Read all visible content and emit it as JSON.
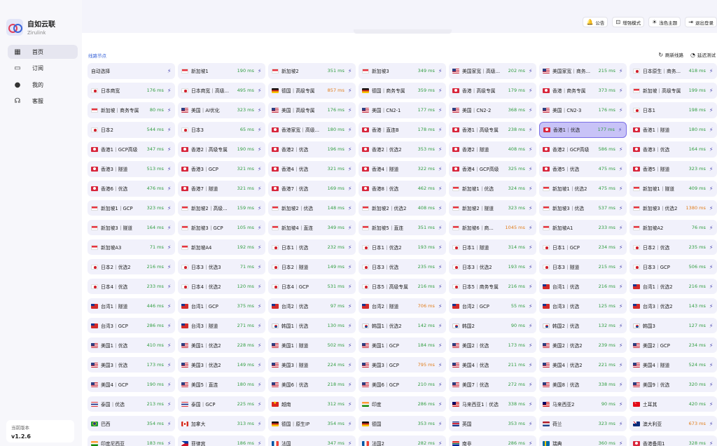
{
  "brand": {
    "name": "自如云联",
    "sub": "Zirulink"
  },
  "nav": [
    {
      "label": "首页",
      "icon": "dashboard-icon",
      "glyph": "▦",
      "active": true
    },
    {
      "label": "订阅",
      "icon": "monitor-icon",
      "glyph": "▭",
      "active": false
    },
    {
      "label": "我的",
      "icon": "user-icon",
      "glyph": "●",
      "active": false
    },
    {
      "label": "客服",
      "icon": "headset-icon",
      "glyph": "☊",
      "active": false
    }
  ],
  "version": {
    "label": "当前版本",
    "value": "v1.2.6"
  },
  "topbar": [
    {
      "label": "公告",
      "icon": "bell-icon",
      "glyph": "🔔"
    },
    {
      "label": "增强模式",
      "icon": "gamepad-icon",
      "glyph": "⊡"
    },
    {
      "label": "浅色主题",
      "icon": "sun-icon",
      "glyph": "☀"
    },
    {
      "label": "退出登录",
      "icon": "logout-icon",
      "glyph": "⇥"
    }
  ],
  "section": {
    "title": "线路节点",
    "refresh": "刷新线路",
    "test": "延迟测试"
  },
  "nodes": [
    {
      "name": "自动选择",
      "flag": "",
      "latency": ""
    },
    {
      "name": "新加坡1",
      "flag": "sg",
      "latency": "190 ms"
    },
    {
      "name": "新加坡2",
      "flag": "sg",
      "latency": "351 ms"
    },
    {
      "name": "新加坡3",
      "flag": "sg",
      "latency": "349 ms"
    },
    {
      "name": "美国家宽｜高级...",
      "flag": "us",
      "latency": "202 ms"
    },
    {
      "name": "美国家宽｜商务...",
      "flag": "us",
      "latency": "215 ms"
    },
    {
      "name": "日本原生｜商务...",
      "flag": "jp",
      "latency": "418 ms"
    },
    {
      "name": "日本商宽",
      "flag": "jp",
      "latency": "176 ms"
    },
    {
      "name": "日本商宽｜高级...",
      "flag": "jp",
      "latency": "495 ms"
    },
    {
      "name": "德国｜高级专属",
      "flag": "de",
      "latency": "857 ms",
      "slow": true
    },
    {
      "name": "德国｜商务专属",
      "flag": "de",
      "latency": "359 ms"
    },
    {
      "name": "香港｜高级专属",
      "flag": "hk",
      "latency": "179 ms"
    },
    {
      "name": "香港｜商务专属",
      "flag": "hk",
      "latency": "373 ms"
    },
    {
      "name": "新加坡｜高级专属",
      "flag": "sg",
      "latency": "199 ms"
    },
    {
      "name": "新加坡｜商务专属",
      "flag": "sg",
      "latency": "80 ms"
    },
    {
      "name": "美国｜AI优化",
      "flag": "us",
      "latency": "323 ms"
    },
    {
      "name": "美国｜高级专属",
      "flag": "us",
      "latency": "176 ms"
    },
    {
      "name": "美国｜CN2-1",
      "flag": "us",
      "latency": "177 ms"
    },
    {
      "name": "美国｜CN2-2",
      "flag": "us",
      "latency": "368 ms"
    },
    {
      "name": "美国｜CN2-3",
      "flag": "us",
      "latency": "176 ms"
    },
    {
      "name": "日本1",
      "flag": "jp",
      "latency": "198 ms"
    },
    {
      "name": "日本2",
      "flag": "jp",
      "latency": "544 ms"
    },
    {
      "name": "日本3",
      "flag": "jp",
      "latency": "65 ms"
    },
    {
      "name": "香港家宽｜高级...",
      "flag": "hk",
      "latency": "180 ms"
    },
    {
      "name": "香港｜直连B",
      "flag": "hk",
      "latency": "178 ms"
    },
    {
      "name": "香港1｜高级专属",
      "flag": "hk",
      "latency": "238 ms"
    },
    {
      "name": "香港1｜优选",
      "flag": "hk",
      "latency": "177 ms",
      "selected": true
    },
    {
      "name": "香港1｜隧道",
      "flag": "hk",
      "latency": "180 ms"
    },
    {
      "name": "香港1｜GCP高级",
      "flag": "hk",
      "latency": "347 ms"
    },
    {
      "name": "香港2｜高级专属",
      "flag": "hk",
      "latency": "190 ms"
    },
    {
      "name": "香港2｜优选",
      "flag": "hk",
      "latency": "196 ms"
    },
    {
      "name": "香港2｜优选2",
      "flag": "hk",
      "latency": "353 ms"
    },
    {
      "name": "香港2｜隧道",
      "flag": "hk",
      "latency": "408 ms"
    },
    {
      "name": "香港2｜GCP高级",
      "flag": "hk",
      "latency": "586 ms"
    },
    {
      "name": "香港3｜优选",
      "flag": "hk",
      "latency": "164 ms"
    },
    {
      "name": "香港3｜隧道",
      "flag": "hk",
      "latency": "513 ms"
    },
    {
      "name": "香港3｜GCP",
      "flag": "hk",
      "latency": "321 ms"
    },
    {
      "name": "香港4｜优选",
      "flag": "hk",
      "latency": "321 ms"
    },
    {
      "name": "香港4｜隧道",
      "flag": "hk",
      "latency": "322 ms"
    },
    {
      "name": "香港4｜GCP高级",
      "flag": "hk",
      "latency": "325 ms"
    },
    {
      "name": "香港5｜优选",
      "flag": "hk",
      "latency": "475 ms"
    },
    {
      "name": "香港5｜隧道",
      "flag": "hk",
      "latency": "323 ms"
    },
    {
      "name": "香港6｜优选",
      "flag": "hk",
      "latency": "476 ms"
    },
    {
      "name": "香港7｜隧道",
      "flag": "hk",
      "latency": "321 ms"
    },
    {
      "name": "香港7｜优选",
      "flag": "hk",
      "latency": "169 ms"
    },
    {
      "name": "香港8｜优选",
      "flag": "hk",
      "latency": "462 ms"
    },
    {
      "name": "新加坡1｜优选",
      "flag": "sg",
      "latency": "324 ms"
    },
    {
      "name": "新加坡1｜优选2",
      "flag": "sg",
      "latency": "475 ms"
    },
    {
      "name": "新加坡1｜隧道",
      "flag": "sg",
      "latency": "409 ms"
    },
    {
      "name": "新加坡1｜GCP",
      "flag": "sg",
      "latency": "323 ms"
    },
    {
      "name": "新加坡2｜高级...",
      "flag": "sg",
      "latency": "159 ms"
    },
    {
      "name": "新加坡2｜优选",
      "flag": "sg",
      "latency": "148 ms"
    },
    {
      "name": "新加坡2｜优选2",
      "flag": "sg",
      "latency": "408 ms"
    },
    {
      "name": "新加坡2｜隧道",
      "flag": "sg",
      "latency": "323 ms"
    },
    {
      "name": "新加坡3｜优选",
      "flag": "sg",
      "latency": "537 ms"
    },
    {
      "name": "新加坡3｜优选2",
      "flag": "sg",
      "latency": "1380 ms",
      "slow": true
    },
    {
      "name": "新加坡3｜隧道",
      "flag": "sg",
      "latency": "164 ms"
    },
    {
      "name": "新加坡3｜GCP",
      "flag": "sg",
      "latency": "105 ms"
    },
    {
      "name": "新加坡4｜直连",
      "flag": "sg",
      "latency": "349 ms"
    },
    {
      "name": "新加坡5｜直连",
      "flag": "sg",
      "latency": "351 ms"
    },
    {
      "name": "新加坡6｜商...",
      "flag": "sg",
      "latency": "1045 ms",
      "slow": true
    },
    {
      "name": "新加坡A1",
      "flag": "sg",
      "latency": "233 ms"
    },
    {
      "name": "新加坡A2",
      "flag": "sg",
      "latency": "76 ms"
    },
    {
      "name": "新加坡A3",
      "flag": "sg",
      "latency": "71 ms"
    },
    {
      "name": "新加坡A4",
      "flag": "sg",
      "latency": "192 ms"
    },
    {
      "name": "日本1｜优选",
      "flag": "jp",
      "latency": "232 ms"
    },
    {
      "name": "日本1｜优选2",
      "flag": "jp",
      "latency": "193 ms"
    },
    {
      "name": "日本1｜隧道",
      "flag": "jp",
      "latency": "314 ms"
    },
    {
      "name": "日本1｜GCP",
      "flag": "jp",
      "latency": "234 ms"
    },
    {
      "name": "日本2｜优选",
      "flag": "jp",
      "latency": "235 ms"
    },
    {
      "name": "日本2｜优选2",
      "flag": "jp",
      "latency": "216 ms"
    },
    {
      "name": "日本3｜优选3",
      "flag": "jp",
      "latency": "71 ms"
    },
    {
      "name": "日本2｜隧道",
      "flag": "jp",
      "latency": "149 ms"
    },
    {
      "name": "日本3｜优选",
      "flag": "jp",
      "latency": "235 ms"
    },
    {
      "name": "日本3｜优选2",
      "flag": "jp",
      "latency": "193 ms"
    },
    {
      "name": "日本3｜隧道",
      "flag": "jp",
      "latency": "215 ms"
    },
    {
      "name": "日本3｜GCP",
      "flag": "jp",
      "latency": "506 ms"
    },
    {
      "name": "日本4｜优选",
      "flag": "jp",
      "latency": "233 ms"
    },
    {
      "name": "日本4｜优选2",
      "flag": "jp",
      "latency": "120 ms"
    },
    {
      "name": "日本4｜GCP",
      "flag": "jp",
      "latency": "531 ms"
    },
    {
      "name": "日本5｜高级专属",
      "flag": "jp",
      "latency": "216 ms"
    },
    {
      "name": "日本5｜商务专属",
      "flag": "jp",
      "latency": "216 ms"
    },
    {
      "name": "台湾1｜优选",
      "flag": "tw",
      "latency": "216 ms"
    },
    {
      "name": "台湾1｜优选2",
      "flag": "tw",
      "latency": "216 ms"
    },
    {
      "name": "台湾1｜隧道",
      "flag": "tw",
      "latency": "446 ms"
    },
    {
      "name": "台湾1｜GCP",
      "flag": "tw",
      "latency": "375 ms"
    },
    {
      "name": "台湾2｜优选",
      "flag": "tw",
      "latency": "97 ms"
    },
    {
      "name": "台湾2｜隧道",
      "flag": "tw",
      "latency": "706 ms",
      "slow": true
    },
    {
      "name": "台湾2｜GCP",
      "flag": "tw",
      "latency": "55 ms"
    },
    {
      "name": "台湾3｜优选",
      "flag": "tw",
      "latency": "125 ms"
    },
    {
      "name": "台湾3｜优选2",
      "flag": "tw",
      "latency": "143 ms"
    },
    {
      "name": "台湾3｜GCP",
      "flag": "tw",
      "latency": "286 ms"
    },
    {
      "name": "台湾3｜隧道",
      "flag": "tw",
      "latency": "271 ms"
    },
    {
      "name": "韩国1｜优选",
      "flag": "kr",
      "latency": "130 ms"
    },
    {
      "name": "韩国1｜优选2",
      "flag": "kr",
      "latency": "142 ms"
    },
    {
      "name": "韩国2",
      "flag": "kr",
      "latency": "90 ms"
    },
    {
      "name": "韩国2｜优选",
      "flag": "kr",
      "latency": "132 ms"
    },
    {
      "name": "韩国3",
      "flag": "kr",
      "latency": "127 ms"
    },
    {
      "name": "美国1｜优选",
      "flag": "us",
      "latency": "410 ms"
    },
    {
      "name": "美国1｜优选2",
      "flag": "us",
      "latency": "228 ms"
    },
    {
      "name": "美国1｜隧道",
      "flag": "us",
      "latency": "502 ms"
    },
    {
      "name": "美国1｜GCP",
      "flag": "us",
      "latency": "184 ms"
    },
    {
      "name": "美国2｜优选",
      "flag": "us",
      "latency": "173 ms"
    },
    {
      "name": "美国2｜优选2",
      "flag": "us",
      "latency": "239 ms"
    },
    {
      "name": "美国2｜GCP",
      "flag": "us",
      "latency": "234 ms"
    },
    {
      "name": "美国3｜优选",
      "flag": "us",
      "latency": "173 ms"
    },
    {
      "name": "美国3｜优选2",
      "flag": "us",
      "latency": "149 ms"
    },
    {
      "name": "美国3｜隧道",
      "flag": "us",
      "latency": "224 ms"
    },
    {
      "name": "美国3｜GCP",
      "flag": "us",
      "latency": "795 ms",
      "slow": true
    },
    {
      "name": "美国4｜优选",
      "flag": "us",
      "latency": "211 ms"
    },
    {
      "name": "美国4｜优选2",
      "flag": "us",
      "latency": "221 ms"
    },
    {
      "name": "美国4｜隧道",
      "flag": "us",
      "latency": "524 ms"
    },
    {
      "name": "美国4｜GCP",
      "flag": "us",
      "latency": "190 ms"
    },
    {
      "name": "美国5｜直连",
      "flag": "us",
      "latency": "180 ms"
    },
    {
      "name": "美国6｜优选",
      "flag": "us",
      "latency": "218 ms"
    },
    {
      "name": "美国6｜GCP",
      "flag": "us",
      "latency": "210 ms"
    },
    {
      "name": "美国7｜优选",
      "flag": "us",
      "latency": "272 ms"
    },
    {
      "name": "美国8｜优选",
      "flag": "us",
      "latency": "338 ms"
    },
    {
      "name": "美国9｜优选",
      "flag": "us",
      "latency": "320 ms"
    },
    {
      "name": "泰国｜优选",
      "flag": "th",
      "latency": "213 ms"
    },
    {
      "name": "泰国｜GCP",
      "flag": "th",
      "latency": "225 ms"
    },
    {
      "name": "越南",
      "flag": "vn",
      "latency": "312 ms"
    },
    {
      "name": "印度",
      "flag": "in",
      "latency": "286 ms"
    },
    {
      "name": "马来西亚1｜优选",
      "flag": "my",
      "latency": "338 ms"
    },
    {
      "name": "马来西亚2",
      "flag": "my",
      "latency": "90 ms"
    },
    {
      "name": "土耳其",
      "flag": "tr",
      "latency": "420 ms"
    },
    {
      "name": "巴西",
      "flag": "br",
      "latency": "354 ms"
    },
    {
      "name": "加拿大",
      "flag": "ca",
      "latency": "313 ms"
    },
    {
      "name": "德国｜原生IP",
      "flag": "de",
      "latency": "354 ms"
    },
    {
      "name": "德国",
      "flag": "de",
      "latency": "353 ms"
    },
    {
      "name": "英国",
      "flag": "gb",
      "latency": "353 ms"
    },
    {
      "name": "荷兰",
      "flag": "nl",
      "latency": "323 ms"
    },
    {
      "name": "澳大利亚",
      "flag": "au",
      "latency": "673 ms",
      "slow": true
    },
    {
      "name": "印度尼西亚",
      "flag": "in",
      "latency": "183 ms"
    },
    {
      "name": "菲律宾",
      "flag": "ph",
      "latency": "186 ms"
    },
    {
      "name": "法国",
      "flag": "fr",
      "latency": "347 ms"
    },
    {
      "name": "法国2",
      "flag": "fr",
      "latency": "282 ms"
    },
    {
      "name": "南非",
      "flag": "za",
      "latency": "286 ms"
    },
    {
      "name": "瑞典",
      "flag": "se",
      "latency": "360 ms"
    },
    {
      "name": "香港备用1",
      "flag": "hk",
      "latency": "328 ms"
    }
  ]
}
